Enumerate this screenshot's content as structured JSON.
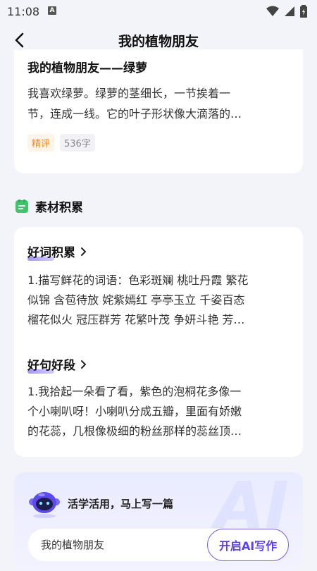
{
  "status": {
    "time": "11:08",
    "a_icon": "A"
  },
  "nav": {
    "title": "我的植物朋友"
  },
  "essay": {
    "title": "我的植物朋友——绿萝",
    "excerpt_line1": "我喜欢绿萝。绿萝的茎细长，一节挨着一",
    "excerpt_line2": "节，连成一线。它的叶子形状像大滴落的…",
    "tag": "精评",
    "word_count": "536字"
  },
  "material": {
    "section_title": "素材积累",
    "words": {
      "title": "好词积累",
      "line1": "1.描写鲜花的词语：色彩斑斓 桃吐丹霞 繁花",
      "line2": "似锦 含苞待放 姹紫嫣红 亭亭玉立 千姿百态",
      "line3": "榴花似火 冠压群芳 花繁叶茂 争妍斗艳 芳…"
    },
    "sentences": {
      "title": "好句好段",
      "line1": "1.我拾起一朵看了看，紫色的泡桐花多像一",
      "line2": "个小喇叭呀！小喇叭分成五瓣，里面有娇嫩",
      "line3": "的花蕊，几根像极细的粉丝那样的蕊丝顶…"
    }
  },
  "ai": {
    "watermark": "AI",
    "prompt": "活学活用，马上写一篇",
    "input_value": "我的植物朋友",
    "button_label": "开启AI写作"
  },
  "colors": {
    "accent": "#6a4ff5",
    "tag_orange": "#f08a1c",
    "green_icon": "#3cc56a"
  }
}
